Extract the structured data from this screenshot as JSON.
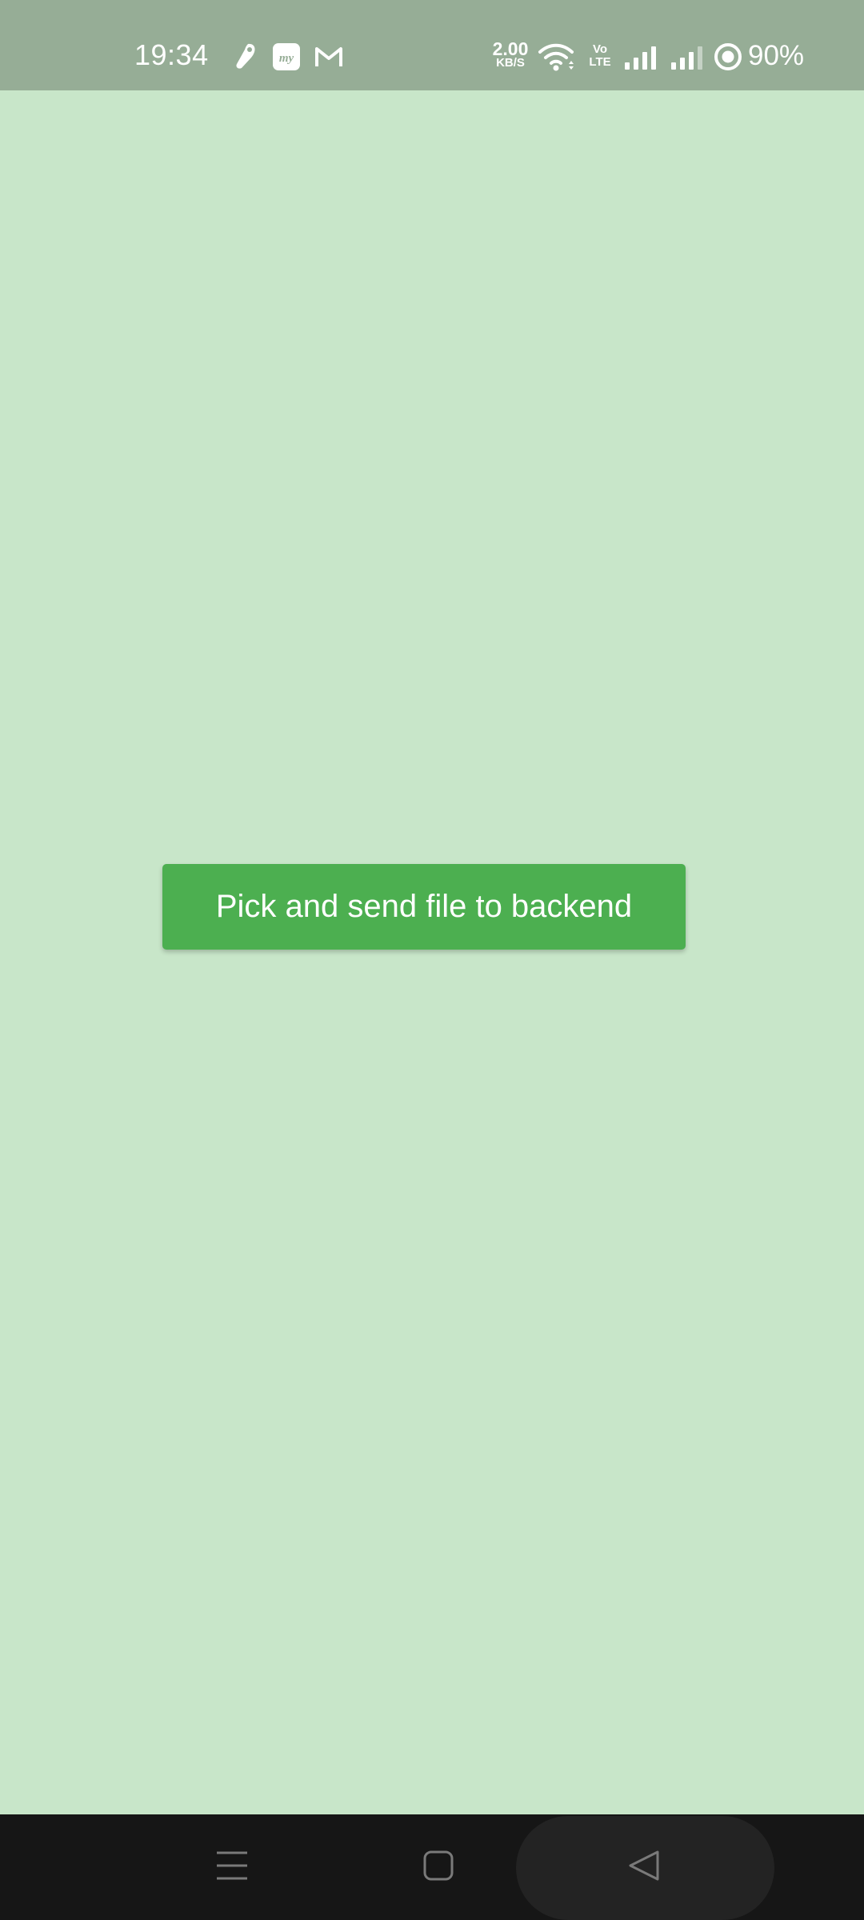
{
  "status_bar": {
    "time": "19:34",
    "network_speed_value": "2.00",
    "network_speed_unit": "KB/S",
    "volte_top": "Vo",
    "volte_bottom": "LTE",
    "battery_percent": "90%",
    "notification_icons": [
      "app-notification-icon",
      "myjio-icon",
      "gmail-icon"
    ],
    "status_icons": [
      "wifi-icon",
      "signal-sim1-icon",
      "signal-sim2-icon",
      "battery-ring-icon"
    ]
  },
  "main": {
    "button_label": "Pick and send file to backend",
    "background_color": "#c8e6c9",
    "button_color": "#4caf50"
  },
  "nav_bar": {
    "buttons": [
      "menu-icon",
      "home-icon",
      "back-icon"
    ]
  }
}
